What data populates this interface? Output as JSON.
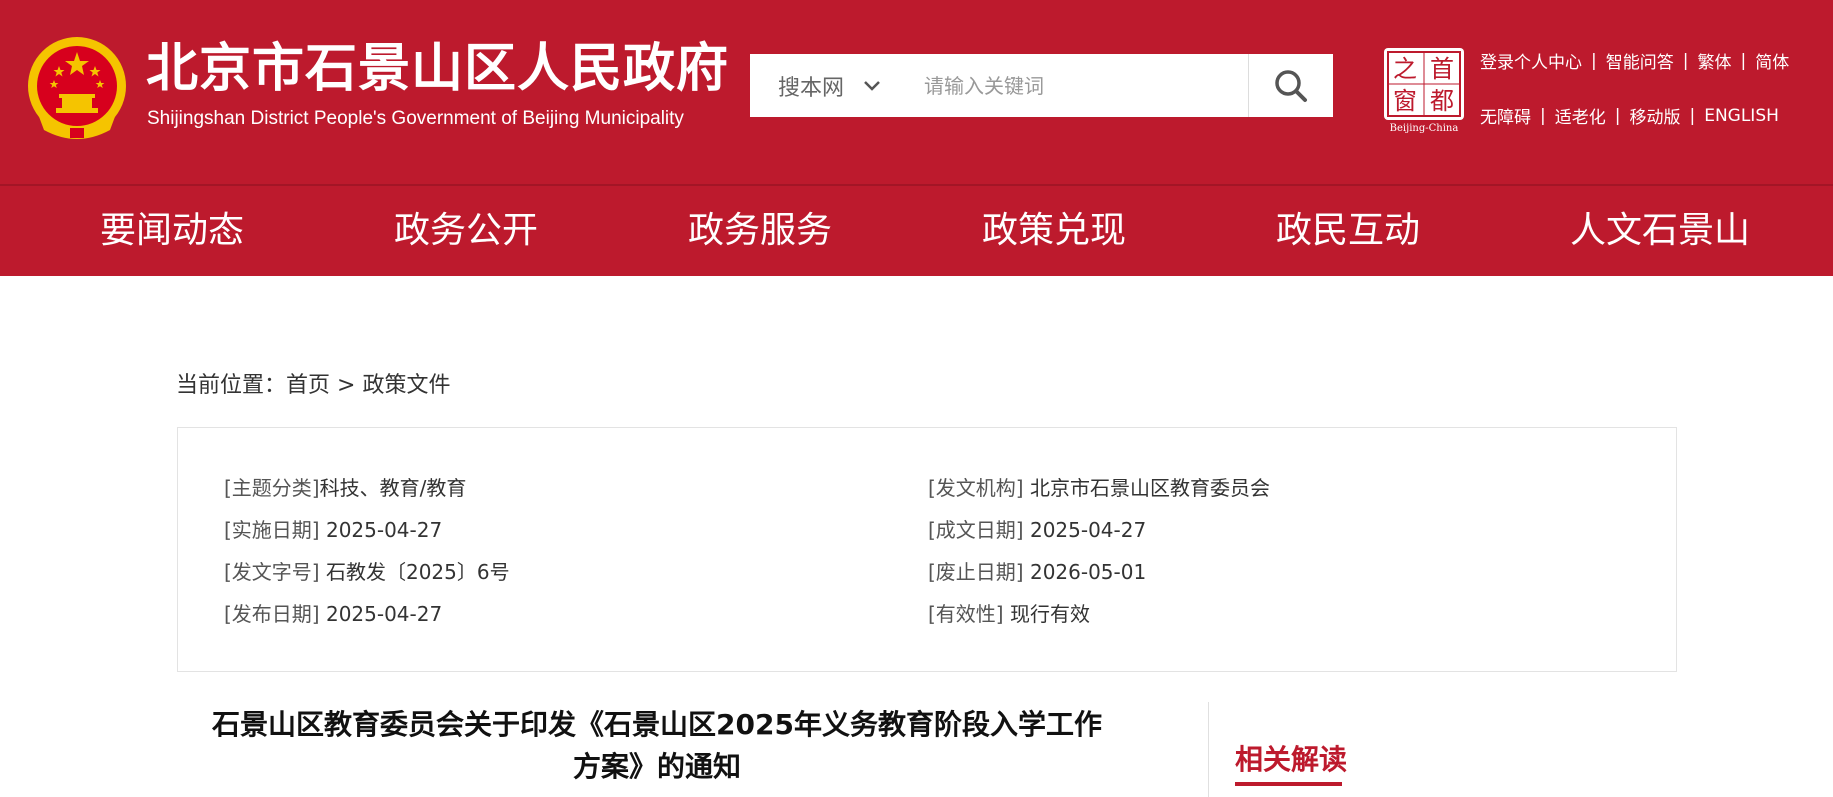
{
  "header": {
    "title": "北京市石景山区人民政府",
    "subtitle": "Shijingshan District People's Government of Beijing Municipality",
    "search": {
      "scope": "搜本网",
      "placeholder": "请输入关键词"
    },
    "capital_logo": {
      "chars": [
        "之",
        "首",
        "窗",
        "都"
      ],
      "caption": "Beijing-China"
    },
    "links_row1": [
      "登录个人中心",
      "智能问答",
      "繁体",
      "简体"
    ],
    "links_row2": [
      "无障碍",
      "适老化",
      "移动版",
      "ENGLISH"
    ],
    "separator": "|"
  },
  "nav": {
    "items": [
      "要闻动态",
      "政务公开",
      "政务服务",
      "政策兑现",
      "政民互动",
      "人文石景山"
    ]
  },
  "breadcrumb": {
    "prefix": "当前位置：",
    "home": "首页",
    "sep": " > ",
    "current": "政策文件"
  },
  "meta": {
    "topic": {
      "label": "[主题分类]",
      "value": "科技、教育/教育"
    },
    "issuer": {
      "label": "[发文机构]",
      "value": " 北京市石景山区教育委员会"
    },
    "effective_date": {
      "label": "[实施日期]",
      "value": " 2025-04-27"
    },
    "written_date": {
      "label": "[成文日期]",
      "value": " 2025-04-27"
    },
    "doc_number": {
      "label": "[发文字号]",
      "value": " 石教发〔2025〕6号"
    },
    "expiry_date": {
      "label": "[废止日期]",
      "value": " 2026-05-01"
    },
    "publish_date": {
      "label": "[发布日期]",
      "value": " 2025-04-27"
    },
    "validity": {
      "label": "[有效性]",
      "value": " 现行有效"
    }
  },
  "document": {
    "title_line1": "石景山区教育委员会关于印发《石景山区2025年义务教育阶段入学工作",
    "title_line2": "方案》的通知"
  },
  "sidebar": {
    "related_title": "相关解读"
  },
  "colors": {
    "brand_red": "#bd1a2d",
    "emblem_gold": "#f5c400"
  },
  "icons": {
    "search": "search-icon",
    "dropdown": "chevron-down-icon",
    "emblem": "national-emblem-icon"
  }
}
